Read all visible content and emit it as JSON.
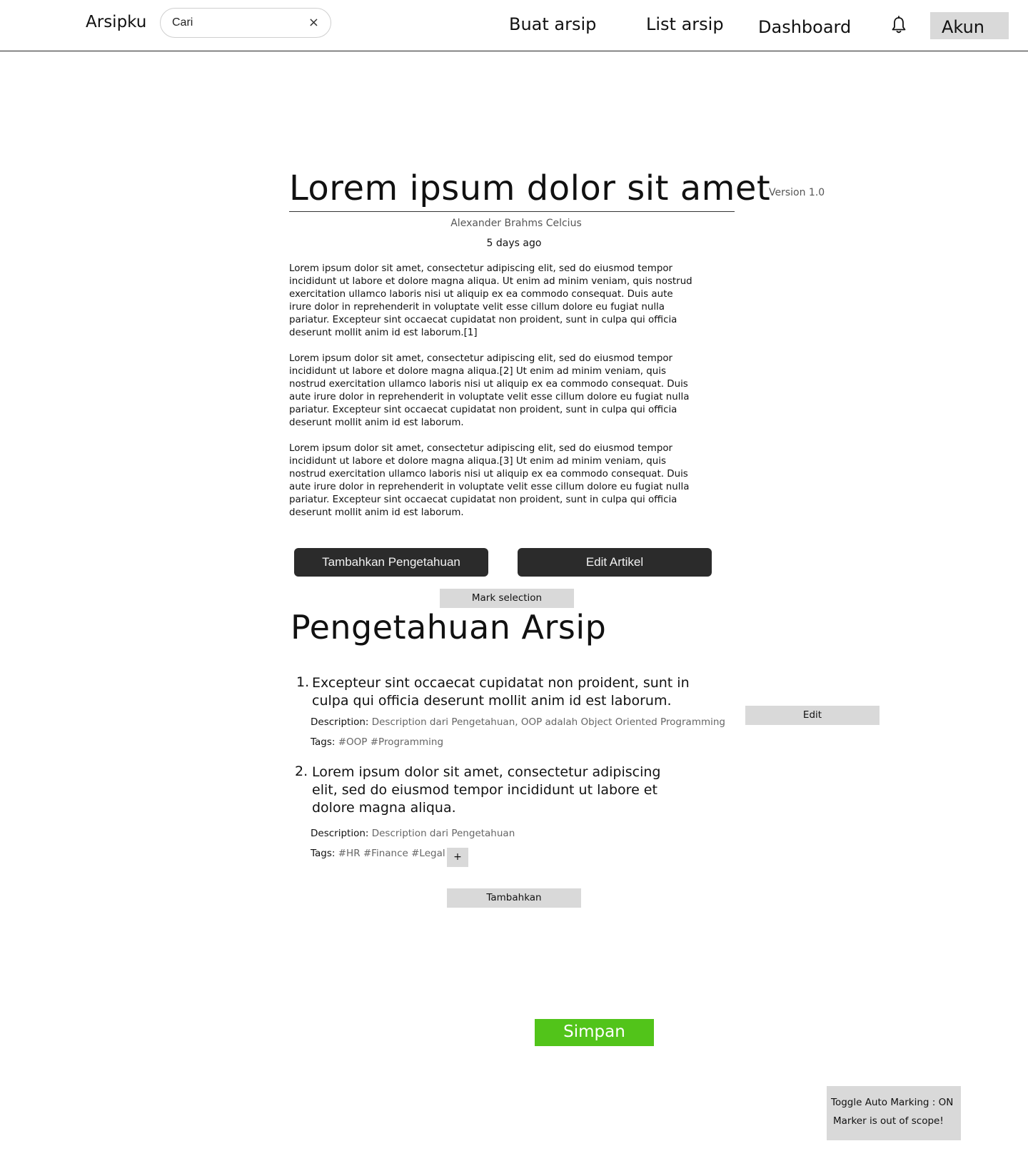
{
  "header": {
    "brand": "Arsipku",
    "search": {
      "value": "Cari",
      "clear_icon": "×"
    },
    "nav": {
      "create": "Buat arsip",
      "list": "List arsip",
      "dashboard": "Dashboard"
    },
    "bell_icon": "bell-icon",
    "account": "Akun"
  },
  "article": {
    "title": "Lorem ipsum dolor sit amet",
    "version": "Version 1.0",
    "author": "Alexander Brahms Celcius",
    "time": "5 days ago",
    "paragraphs": [
      "Lorem ipsum dolor sit amet, consectetur adipiscing elit, sed do eiusmod tempor incididunt ut labore et dolore magna aliqua. Ut enim ad minim veniam, quis nostrud exercitation ullamco laboris nisi ut aliquip ex ea commodo consequat. Duis aute irure dolor in reprehenderit in voluptate velit esse cillum dolore eu fugiat nulla pariatur. Excepteur sint occaecat cupidatat non proident, sunt in culpa qui officia deserunt mollit anim id est laborum.[1]",
      "Lorem ipsum dolor sit amet, consectetur adipiscing elit, sed do eiusmod tempor incididunt ut labore et dolore magna aliqua.[2] Ut enim ad minim veniam, quis nostrud exercitation ullamco laboris nisi ut aliquip ex ea commodo consequat. Duis aute irure dolor in reprehenderit in voluptate velit esse cillum dolore eu fugiat nulla pariatur. Excepteur sint occaecat cupidatat non proident, sunt in culpa qui officia deserunt mollit anim id est laborum.",
      "Lorem ipsum dolor sit amet, consectetur adipiscing elit, sed do eiusmod tempor incididunt ut labore et dolore magna aliqua.[3] Ut enim ad minim veniam, quis nostrud exercitation ullamco laboris nisi ut aliquip ex ea commodo consequat. Duis aute irure dolor in reprehenderit in voluptate velit esse cillum dolore eu fugiat nulla pariatur. Excepteur sint occaecat cupidatat non proident, sunt in culpa qui officia deserunt mollit anim id est laborum."
    ]
  },
  "actions": {
    "add_knowledge": "Tambahkan Pengetahuan",
    "edit_article": "Edit Artikel",
    "mark_selection": "Mark selection"
  },
  "knowledge": {
    "title": "Pengetahuan Arsip",
    "desc_label": "Description:",
    "tags_label": "Tags:",
    "items": [
      {
        "num": "1.",
        "text": "Excepteur sint occaecat cupidatat non proident, sunt in culpa qui officia deserunt mollit anim id est laborum.",
        "description": "Description dari Pengetahuan, OOP adalah Object Oriented Programming",
        "tags": "#OOP #Programming"
      },
      {
        "num": "2.",
        "text": "Lorem ipsum dolor sit amet, consectetur adipiscing elit, sed do eiusmod tempor incididunt ut labore et dolore magna aliqua.",
        "description": "Description dari Pengetahuan",
        "tags": "#HR #Finance #Legal"
      }
    ],
    "edit_label": "Edit",
    "add_tag_label": "+",
    "add_label": "Tambahkan"
  },
  "save_label": "Simpan",
  "toggle": {
    "auto_marking": "Toggle Auto Marking : ON",
    "scope_note": "Marker is out of scope!"
  },
  "colors": {
    "save_button": "#52c41a",
    "dark_button": "#2b2b2b",
    "gray_button": "#d9d9d9"
  }
}
